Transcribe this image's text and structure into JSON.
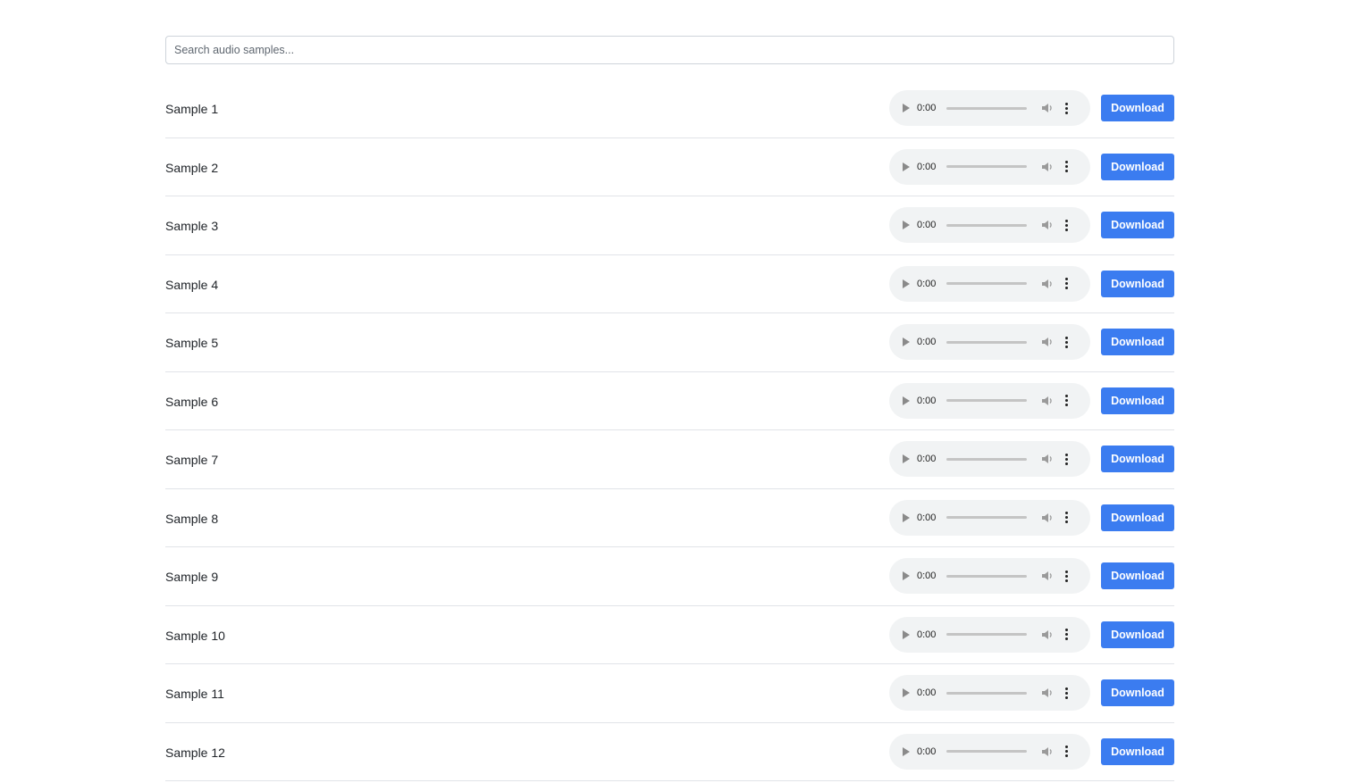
{
  "search": {
    "placeholder": "Search audio samples...",
    "value": ""
  },
  "samples": [
    {
      "name": "Sample 1",
      "time": "0:00",
      "download_label": "Download"
    },
    {
      "name": "Sample 2",
      "time": "0:00",
      "download_label": "Download"
    },
    {
      "name": "Sample 3",
      "time": "0:00",
      "download_label": "Download"
    },
    {
      "name": "Sample 4",
      "time": "0:00",
      "download_label": "Download"
    },
    {
      "name": "Sample 5",
      "time": "0:00",
      "download_label": "Download"
    },
    {
      "name": "Sample 6",
      "time": "0:00",
      "download_label": "Download"
    },
    {
      "name": "Sample 7",
      "time": "0:00",
      "download_label": "Download"
    },
    {
      "name": "Sample 8",
      "time": "0:00",
      "download_label": "Download"
    },
    {
      "name": "Sample 9",
      "time": "0:00",
      "download_label": "Download"
    },
    {
      "name": "Sample 10",
      "time": "0:00",
      "download_label": "Download"
    },
    {
      "name": "Sample 11",
      "time": "0:00",
      "download_label": "Download"
    },
    {
      "name": "Sample 12",
      "time": "0:00",
      "download_label": "Download"
    }
  ],
  "colors": {
    "accent": "#3b7cf0",
    "player_bg": "#f1f3f4",
    "divider": "#e1e4e8"
  }
}
